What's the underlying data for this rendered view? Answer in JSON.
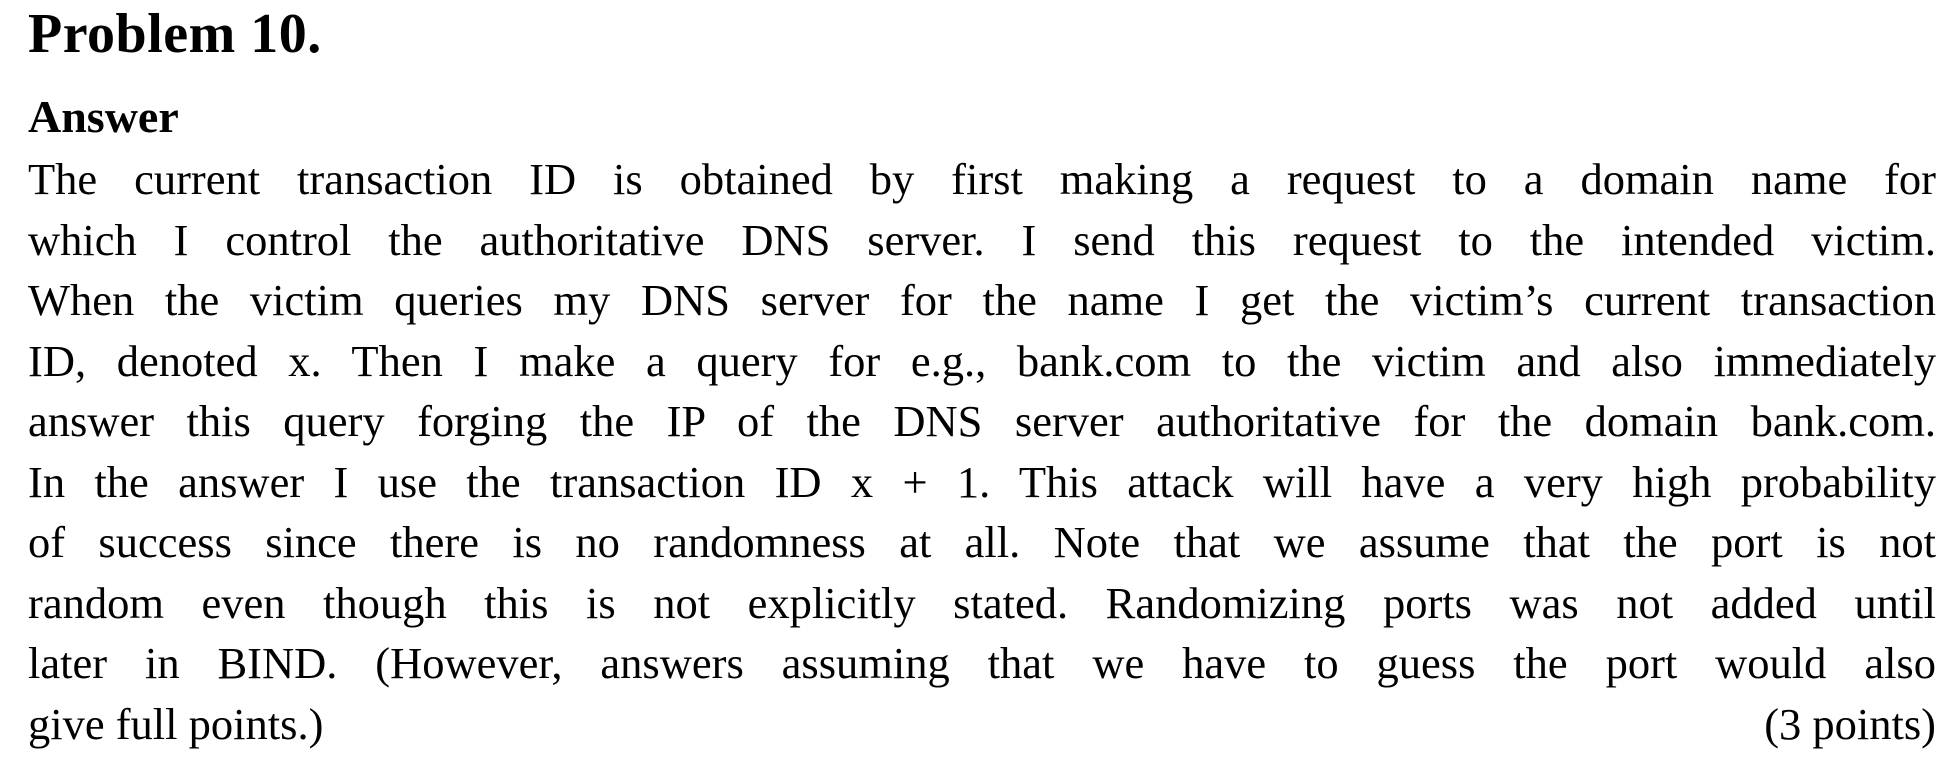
{
  "problem": {
    "title": "Problem 10."
  },
  "answer": {
    "heading": "Answer",
    "lines": [
      "The current transaction ID is obtained by first making a request to a domain name for",
      "which I control the authoritative DNS server. I send this request to the intended victim.",
      "When the victim queries my DNS server for the name I get the victim’s current transaction",
      "ID, denoted x. Then I make a query for e.g., bank.com to the victim and also immediately",
      "answer this query forging the IP of the DNS server authoritative for the domain bank.com.",
      "In the answer I use the transaction ID x + 1. This attack will have a very high probability",
      "of success since there is no randomness at all. Note that we assume that the port is not",
      "random even though this is not explicitly stated. Randomizing ports was not added until",
      "later in BIND. (However, answers assuming that we have to guess the port would also",
      "give full points.)"
    ],
    "points": "(3 points)"
  }
}
